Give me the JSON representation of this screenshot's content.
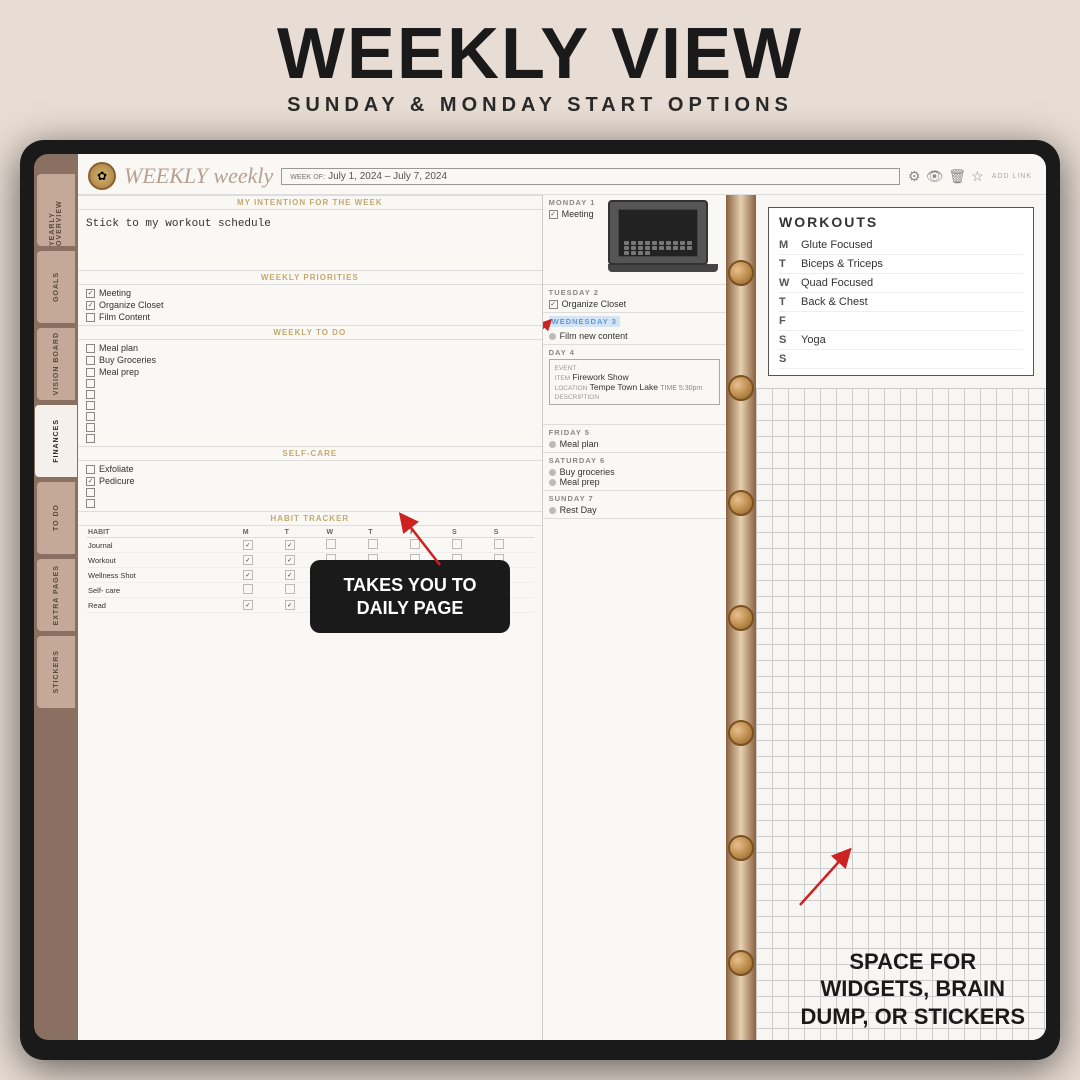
{
  "header": {
    "title": "WEEKLY VIEW",
    "subtitle": "SUNDAY & MONDAY START OPTIONS"
  },
  "planner": {
    "logo": "WEEKLY weekly",
    "week_of_label": "WEEK OF:",
    "week_of_value": "July 1, 2024 – July 7, 2024",
    "add_link": "ADD LINK",
    "intention_label": "MY INTENTION FOR THE WEEK",
    "intention_text": "Stick to my workout schedule",
    "priorities_label": "WEEKLY PRIORITIES",
    "priorities": [
      {
        "checked": true,
        "text": "Meeting"
      },
      {
        "checked": true,
        "text": "Organize Closet"
      },
      {
        "checked": false,
        "text": "Film Content"
      }
    ],
    "todo_label": "WEEKLY TO DO",
    "todos": [
      {
        "checked": false,
        "text": "Meal plan"
      },
      {
        "checked": false,
        "text": "Buy Groceries"
      },
      {
        "checked": false,
        "text": "Meal prep"
      },
      {
        "checked": false,
        "text": ""
      },
      {
        "checked": false,
        "text": ""
      },
      {
        "checked": false,
        "text": ""
      },
      {
        "checked": false,
        "text": ""
      },
      {
        "checked": false,
        "text": ""
      },
      {
        "checked": false,
        "text": ""
      }
    ],
    "selfcare_label": "SELF-CARE",
    "selfcare": [
      {
        "checked": false,
        "text": "Exfoliate"
      },
      {
        "checked": true,
        "text": "Pedicure"
      },
      {
        "checked": false,
        "text": ""
      },
      {
        "checked": false,
        "text": ""
      }
    ],
    "habit_label": "HABIT TRACKER",
    "habit_cols": [
      "HABIT",
      "M",
      "T",
      "W",
      "T",
      "F",
      "S",
      "S"
    ],
    "habits": [
      {
        "name": "Journal",
        "checks": [
          true,
          true,
          false,
          false,
          false,
          false,
          false
        ]
      },
      {
        "name": "Workout",
        "checks": [
          true,
          true,
          false,
          false,
          false,
          false,
          false
        ]
      },
      {
        "name": "Wellness Shot",
        "checks": [
          true,
          true,
          false,
          false,
          false,
          false,
          false
        ]
      },
      {
        "name": "Self- care",
        "checks": [
          false,
          false,
          false,
          false,
          false,
          false,
          false
        ]
      },
      {
        "name": "Read",
        "checks": [
          true,
          true,
          false,
          false,
          false,
          false,
          false
        ]
      }
    ],
    "days": [
      {
        "label": "MONDAY 1",
        "items": [
          {
            "checked": true,
            "text": "Meeting"
          }
        ],
        "has_laptop": true
      },
      {
        "label": "TUESDAY 2",
        "items": [
          {
            "checked": true,
            "text": "Organize Closet"
          }
        ]
      },
      {
        "label": "WEDNESDAY 3",
        "highlighted": true,
        "items": [
          {
            "dot": true,
            "text": "Film new content"
          }
        ]
      },
      {
        "label": "DAY 4",
        "items": [],
        "event": {
          "label_event": "EVENT",
          "label_item": "ITEM",
          "item": "Firework Show",
          "label_location": "LOCATION",
          "location": "Tempe Town Lake",
          "time": "5:30pm",
          "label_description": "DESCRIPTION"
        }
      },
      {
        "label": "FRIDAY 5",
        "items": [
          {
            "dot": true,
            "text": "Meal plan"
          }
        ]
      },
      {
        "label": "SATURDAY 6",
        "items": [
          {
            "dot": true,
            "text": "Buy groceries"
          },
          {
            "dot": true,
            "text": "Meal prep"
          }
        ]
      },
      {
        "label": "SUNDAY 7",
        "items": [
          {
            "dot": true,
            "text": "Rest Day"
          }
        ]
      }
    ]
  },
  "workouts": {
    "title": "WORKOUTS",
    "entries": [
      {
        "day": "M",
        "workout": "Glute Focused"
      },
      {
        "day": "T",
        "workout": "Biceps & Triceps"
      },
      {
        "day": "W",
        "workout": "Quad Focused"
      },
      {
        "day": "T",
        "workout": "Back & Chest"
      },
      {
        "day": "F",
        "workout": ""
      },
      {
        "day": "S",
        "workout": "Yoga"
      },
      {
        "day": "S",
        "workout": ""
      }
    ]
  },
  "callouts": {
    "daily_page": "TAKES YOU TO\nDAILY PAGE",
    "widgets": "SPACE FOR\nWIDGETS, BRAIN\nDUMP, OR STICKERS"
  },
  "sidebar_tabs": [
    {
      "label": "YEARLY OVERVIEW"
    },
    {
      "label": "GOALS"
    },
    {
      "label": "VISION BOARD"
    },
    {
      "label": "FINANCES"
    },
    {
      "label": "TO DO"
    },
    {
      "label": "EXTRA PAGES"
    },
    {
      "label": "STICKERS"
    }
  ]
}
